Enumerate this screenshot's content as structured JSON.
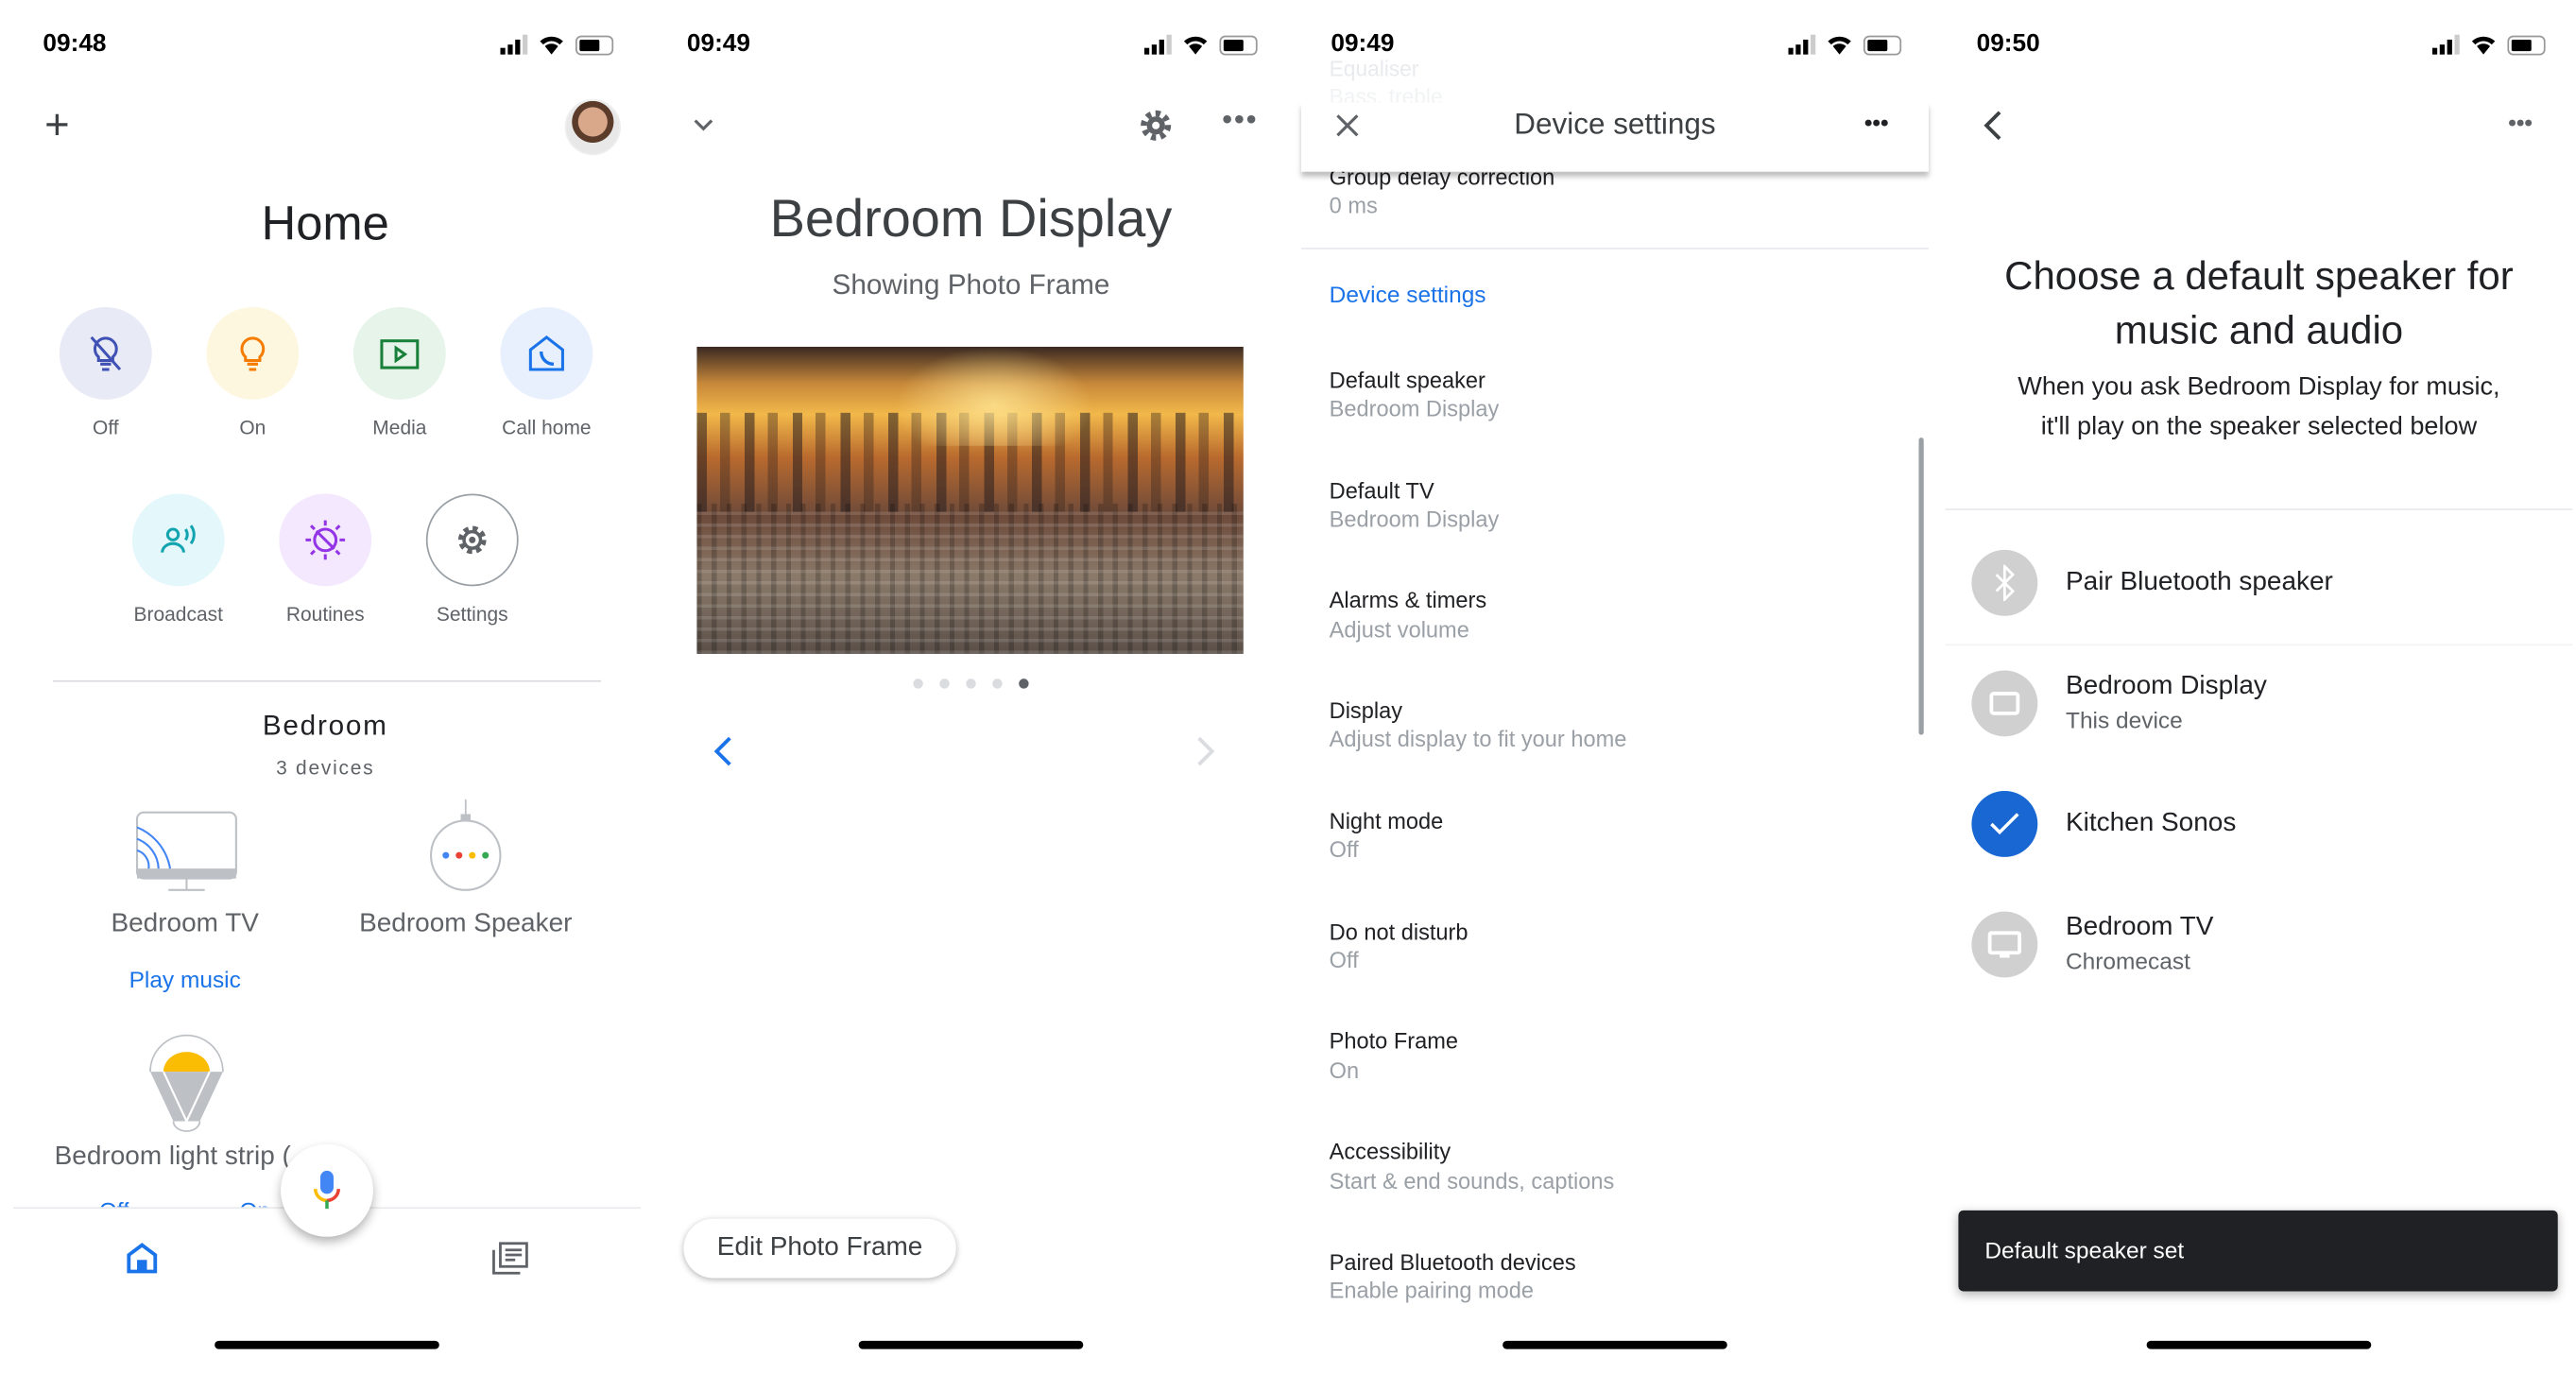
{
  "panels": {
    "home": {
      "status_time": "09:48",
      "title": "Home",
      "quick_actions": [
        {
          "label": "Off",
          "icon": "light-off-icon",
          "color": "#3f51b5",
          "bg": "#e8eaf6"
        },
        {
          "label": "On",
          "icon": "light-bulb-icon",
          "color": "#f57c00",
          "bg": "#fef7e0"
        },
        {
          "label": "Media",
          "icon": "play-screen-icon",
          "color": "#188038",
          "bg": "#e6f4ea"
        },
        {
          "label": "Call home",
          "icon": "call-home-icon",
          "color": "#1a73e8",
          "bg": "#e8f0fe"
        },
        {
          "label": "Broadcast",
          "icon": "broadcast-icon",
          "color": "#12a4af",
          "bg": "#e4f7fb"
        },
        {
          "label": "Routines",
          "icon": "routines-icon",
          "color": "#9334e6",
          "bg": "#f3e8fd"
        },
        {
          "label": "Settings",
          "icon": "gear-icon",
          "color": "#5f6368",
          "bg": "#ffffff"
        }
      ],
      "room": {
        "name": "Bedroom",
        "count": "3 devices"
      },
      "devices": [
        {
          "name": "Bedroom TV",
          "action": "Play music"
        },
        {
          "name": "Bedroom Speaker"
        },
        {
          "name": "Bedroom light strip (",
          "actions": [
            "Off",
            "On"
          ]
        }
      ]
    },
    "display": {
      "status_time": "09:49",
      "title": "Bedroom Display",
      "subtitle": "Showing Photo Frame",
      "carousel_active_index": 4,
      "carousel_count": 5,
      "edit_button": "Edit Photo Frame"
    },
    "device_settings": {
      "status_time": "09:49",
      "faded_title": "Equaliser",
      "faded_sub": "Bass, treble",
      "header_title": "Device settings",
      "group_delay": {
        "title": "Group delay correction",
        "value": "0 ms"
      },
      "section_title": "Device settings",
      "items": [
        {
          "title": "Default speaker",
          "value": "Bedroom Display"
        },
        {
          "title": "Default TV",
          "value": "Bedroom Display"
        },
        {
          "title": "Alarms & timers",
          "value": "Adjust volume"
        },
        {
          "title": "Display",
          "value": "Adjust display to fit your home"
        },
        {
          "title": "Night mode",
          "value": "Off"
        },
        {
          "title": "Do not disturb",
          "value": "Off"
        },
        {
          "title": "Photo Frame",
          "value": "On"
        },
        {
          "title": "Accessibility",
          "value": "Start & end sounds, captions"
        },
        {
          "title": "Paired Bluetooth devices",
          "value": "Enable pairing mode"
        }
      ]
    },
    "default_speaker": {
      "status_time": "09:50",
      "heading_line1": "Choose a default speaker for",
      "heading_line2": "music and audio",
      "sub_line1": "When you ask Bedroom Display for music,",
      "sub_line2": "it'll play on the speaker selected below",
      "pair_label": "Pair Bluetooth speaker",
      "speakers": [
        {
          "name": "Bedroom Display",
          "sub": "This device",
          "selected": false,
          "icon": "display-icon"
        },
        {
          "name": "Kitchen Sonos",
          "selected": true,
          "icon": "check-icon"
        },
        {
          "name": "Bedroom TV",
          "sub": "Chromecast",
          "selected": false,
          "icon": "tv-icon"
        }
      ],
      "toast": "Default speaker set"
    }
  },
  "colors": {
    "accent": "#1a73e8",
    "selected": "#1967d2",
    "toast_bg": "#202124"
  }
}
